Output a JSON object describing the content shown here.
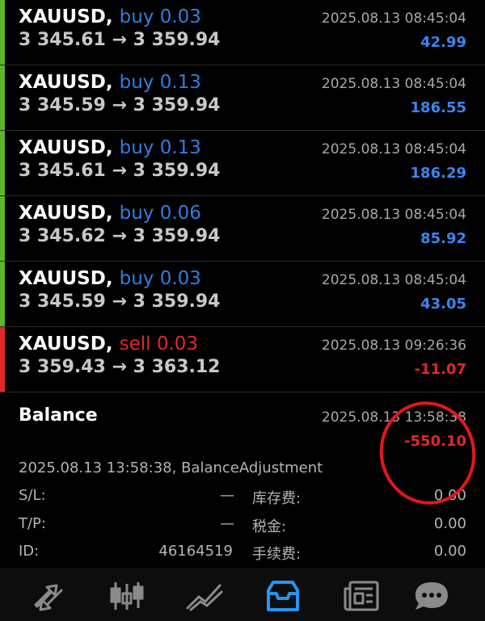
{
  "colors": {
    "buy": "#2f7de1",
    "sell": "#e0282a",
    "buy_bar": "#5fb52a",
    "sell_bar": "#e0282a",
    "profit_positive": "#3a85f0",
    "profit_negative": "#e0282a",
    "nav_active": "#2196f3",
    "nav_inactive": "#8a8a8a",
    "annotation": "#e3171a"
  },
  "deals": [
    {
      "symbol": "XAUUSD,",
      "direction": "buy 0.03",
      "type": "buy",
      "prices": "3 345.61 → 3 359.94",
      "time": "2025.08.13 08:45:04",
      "profit": "42.99",
      "profit_sign": "positive"
    },
    {
      "symbol": "XAUUSD,",
      "direction": "buy 0.13",
      "type": "buy",
      "prices": "3 345.59 → 3 359.94",
      "time": "2025.08.13 08:45:04",
      "profit": "186.55",
      "profit_sign": "positive"
    },
    {
      "symbol": "XAUUSD,",
      "direction": "buy 0.13",
      "type": "buy",
      "prices": "3 345.61 → 3 359.94",
      "time": "2025.08.13 08:45:04",
      "profit": "186.29",
      "profit_sign": "positive"
    },
    {
      "symbol": "XAUUSD,",
      "direction": "buy 0.06",
      "type": "buy",
      "prices": "3 345.62 → 3 359.94",
      "time": "2025.08.13 08:45:04",
      "profit": "85.92",
      "profit_sign": "positive"
    },
    {
      "symbol": "XAUUSD,",
      "direction": "buy 0.03",
      "type": "buy",
      "prices": "3 345.59 → 3 359.94",
      "time": "2025.08.13 08:45:04",
      "profit": "43.05",
      "profit_sign": "positive"
    },
    {
      "symbol": "XAUUSD,",
      "direction": "sell 0.03",
      "type": "sell",
      "prices": "3 359.43 → 3 363.12",
      "time": "2025.08.13 09:26:36",
      "profit": "-11.07",
      "profit_sign": "negative"
    }
  ],
  "balance": {
    "title": "Balance",
    "time": "2025.08.13 13:58:38",
    "profit": "-550.10",
    "comment": "2025.08.13 13:58:38, BalanceAdjustment",
    "sl_label": "S/L:",
    "sl_value": "—",
    "tp_label": "T/P:",
    "tp_value": "—",
    "id_label": "ID:",
    "id_value": "46164519",
    "swap_label": "库存费:",
    "swap_value": "0.00",
    "tax_label": "税金:",
    "tax_value": "0.00",
    "commission_label": "手续费:",
    "commission_value": "0.00"
  },
  "nav": [
    {
      "icon": "trade-arrows-icon",
      "active": false
    },
    {
      "icon": "candlestick-chart-icon",
      "active": false
    },
    {
      "icon": "trend-chart-icon",
      "active": false
    },
    {
      "icon": "history-inbox-icon",
      "active": true
    },
    {
      "icon": "news-icon",
      "active": false
    },
    {
      "icon": "chat-icon",
      "active": false
    }
  ]
}
